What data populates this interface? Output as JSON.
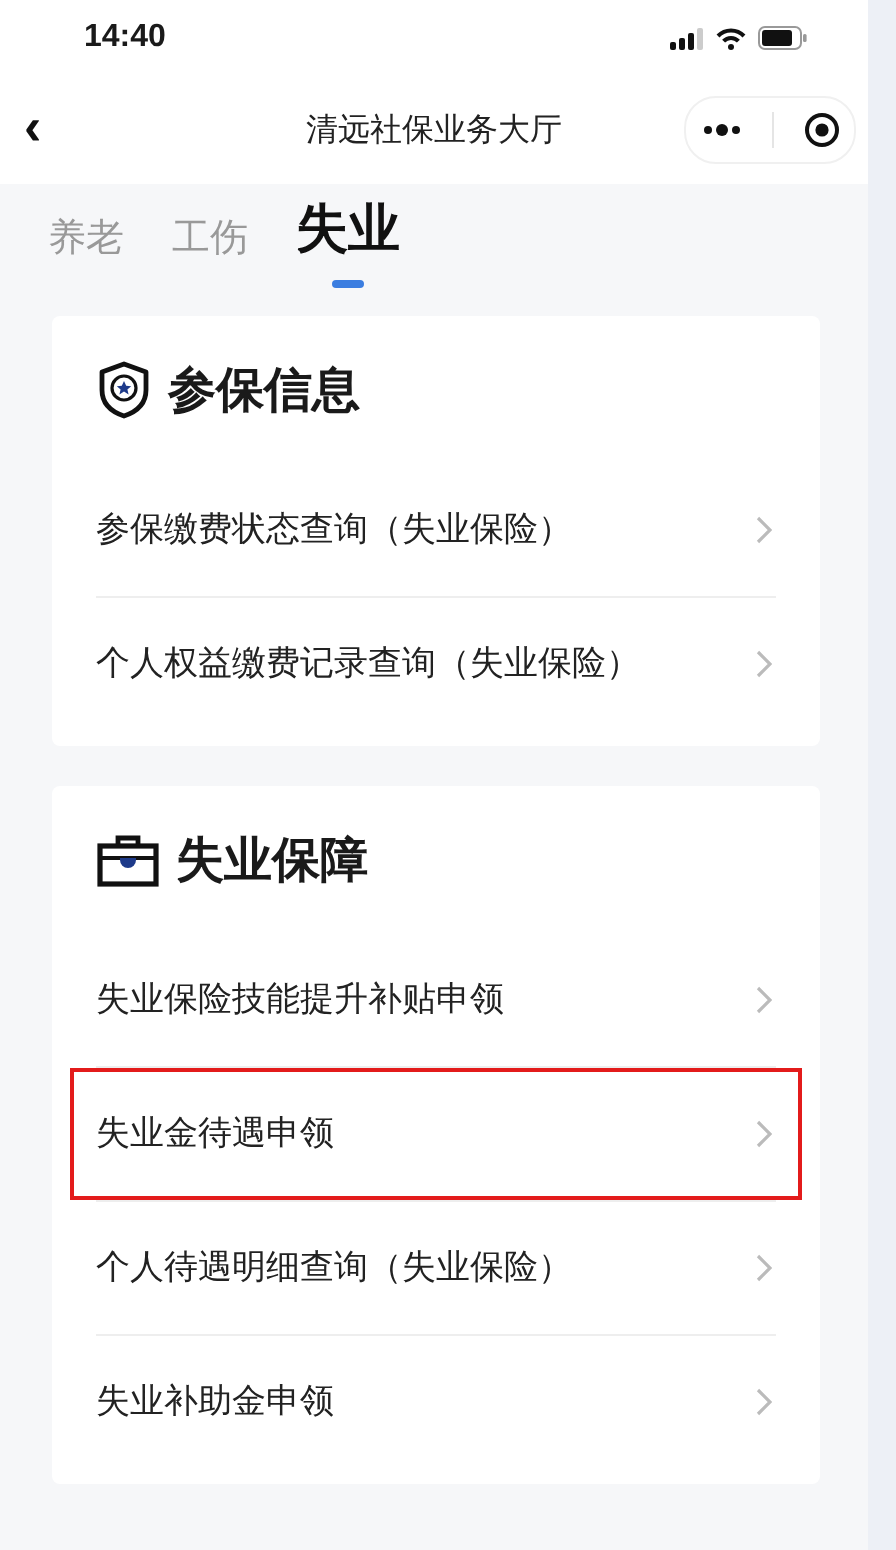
{
  "status_bar": {
    "time": "14:40"
  },
  "nav_bar": {
    "back": "‹",
    "title": "清远社保业务大厅"
  },
  "tabs": [
    {
      "label": "养老",
      "selected": false
    },
    {
      "label": "工伤",
      "selected": false
    },
    {
      "label": "失业",
      "selected": true
    }
  ],
  "sections": [
    {
      "title": "参保信息",
      "items": [
        {
          "label": "参保缴费状态查询（失业保险）",
          "highlighted": false
        },
        {
          "label": "个人权益缴费记录查询（失业保险）",
          "highlighted": false
        }
      ]
    },
    {
      "title": "失业保障",
      "items": [
        {
          "label": "失业保险技能提升补贴申领",
          "highlighted": false
        },
        {
          "label": "失业金待遇申领",
          "highlighted": true
        },
        {
          "label": "个人待遇明细查询（失业保险）",
          "highlighted": false
        },
        {
          "label": "失业补助金申领",
          "highlighted": false
        }
      ]
    }
  ]
}
